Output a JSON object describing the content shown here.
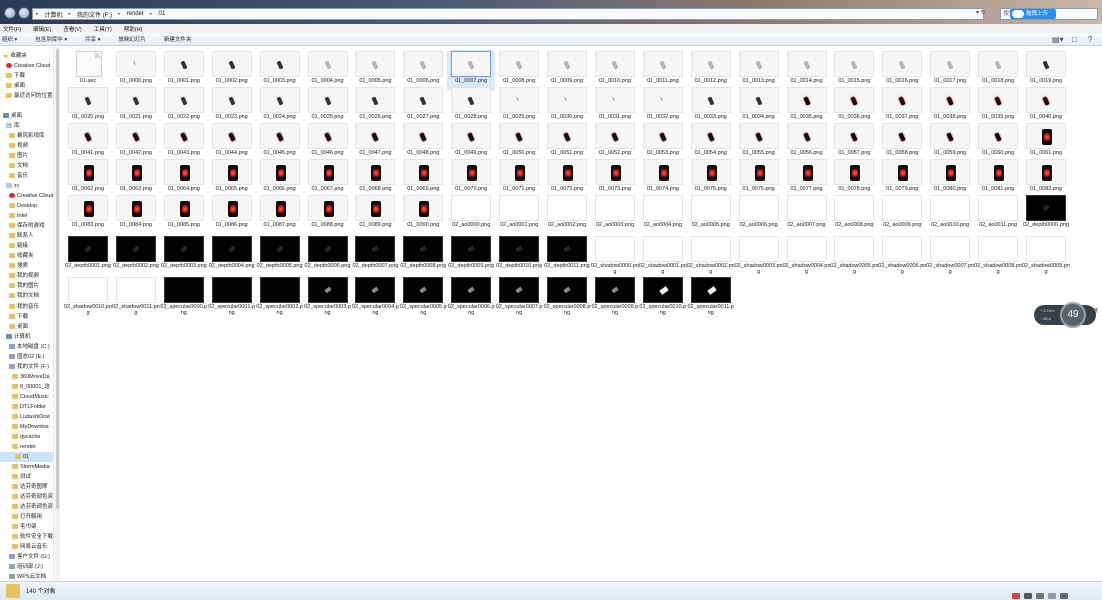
{
  "address": {
    "crumbs": [
      "计算机",
      "我的文件 (F:)",
      "render",
      "01"
    ],
    "search_placeholder": "搜索",
    "upload_label": "拖拽上传"
  },
  "menu": [
    "文件(F)",
    "编辑(E)",
    "查看(V)",
    "工具(T)",
    "帮助(H)"
  ],
  "toolbar": [
    "组织 ▾",
    "包含到库中 ▾",
    "共享 ▾",
    "放映幻灯片",
    "新建文件夹"
  ],
  "sidebar": [
    {
      "label": "收藏夹",
      "icon": "star-icon"
    },
    {
      "label": "Creative Cloud",
      "icon": "creative-cloud-icon"
    },
    {
      "label": "下载",
      "icon": "folder-icon"
    },
    {
      "label": "桌面",
      "icon": "folder-icon"
    },
    {
      "label": "最近访问的位置",
      "icon": "folder-icon"
    },
    {
      "label": "",
      "icon": ""
    },
    {
      "label": "桌面",
      "icon": "desktop-icon"
    },
    {
      "label": "库",
      "icon": "library-icon"
    },
    {
      "label": "暴风影视库",
      "icon": "folder-icon"
    },
    {
      "label": "视频",
      "icon": "folder-icon"
    },
    {
      "label": "图片",
      "icon": "folder-icon"
    },
    {
      "label": "文档",
      "icon": "folder-icon"
    },
    {
      "label": "音乐",
      "icon": "folder-icon"
    },
    {
      "label": "zc",
      "icon": "user-icon"
    },
    {
      "label": "Creative Cloud",
      "icon": "creative-cloud-icon"
    },
    {
      "label": "Desktop",
      "icon": "folder-icon"
    },
    {
      "label": "Intel",
      "icon": "folder-icon"
    },
    {
      "label": "保存的游戏",
      "icon": "folder-icon"
    },
    {
      "label": "联系人",
      "icon": "folder-icon"
    },
    {
      "label": "链接",
      "icon": "folder-icon"
    },
    {
      "label": "收藏夹",
      "icon": "folder-icon"
    },
    {
      "label": "搜索",
      "icon": "folder-icon"
    },
    {
      "label": "我的视频",
      "icon": "folder-icon"
    },
    {
      "label": "我的图片",
      "icon": "folder-icon"
    },
    {
      "label": "我的文档",
      "icon": "folder-icon"
    },
    {
      "label": "我的音乐",
      "icon": "folder-icon"
    },
    {
      "label": "下载",
      "icon": "folder-icon"
    },
    {
      "label": "桌面",
      "icon": "folder-icon"
    },
    {
      "label": "计算机",
      "icon": "computer-icon"
    },
    {
      "label": "本地磁盘 (C:)",
      "icon": "drive-icon"
    },
    {
      "label": "固态02 (E:)",
      "icon": "drive-icon"
    },
    {
      "label": "我的文件 (F:)",
      "icon": "drive-icon"
    },
    {
      "label": "360MoveDa",
      "icon": "folder-icon"
    },
    {
      "label": "8_00001_这",
      "icon": "folder-icon"
    },
    {
      "label": "CloudMusic",
      "icon": "folder-icon"
    },
    {
      "label": "DTLFolder",
      "icon": "folder-icon"
    },
    {
      "label": "LudashiDow",
      "icon": "folder-icon"
    },
    {
      "label": "MyDownloa",
      "icon": "folder-icon"
    },
    {
      "label": "qycache",
      "icon": "folder-icon"
    },
    {
      "label": "render",
      "icon": "folder-icon"
    },
    {
      "label": "01",
      "icon": "folder-icon",
      "selected": true
    },
    {
      "label": "StormMedia",
      "icon": "folder-icon"
    },
    {
      "label": "测试",
      "icon": "folder-icon"
    },
    {
      "label": "达芬奇图摩",
      "icon": "folder-icon"
    },
    {
      "label": "达芬奇调色资",
      "icon": "folder-icon"
    },
    {
      "label": "达芬奇调色资",
      "icon": "folder-icon"
    },
    {
      "label": "打开解用",
      "icon": "folder-icon"
    },
    {
      "label": "毛巾架",
      "icon": "folder-icon"
    },
    {
      "label": "软件安全下载",
      "icon": "folder-icon"
    },
    {
      "label": "网易云音乐",
      "icon": "folder-icon"
    },
    {
      "label": "客户文件 (G:)",
      "icon": "drive-icon"
    },
    {
      "label": "培训部 (J:)",
      "icon": "drive-icon"
    },
    {
      "label": "WPS云文档",
      "icon": "cloud-drive-icon"
    }
  ],
  "files": [
    {
      "name": "01.aec",
      "kind": "doc"
    },
    {
      "name": "01_0000.png",
      "kind": "tiny"
    },
    {
      "name": "01_0001.png",
      "kind": "small"
    },
    {
      "name": "01_0002.png",
      "kind": "small"
    },
    {
      "name": "01_0003.png",
      "kind": "small"
    },
    {
      "name": "01_0004.png",
      "kind": "light"
    },
    {
      "name": "01_0005.png",
      "kind": "light"
    },
    {
      "name": "01_0006.png",
      "kind": "light"
    },
    {
      "name": "01_0007.png",
      "kind": "light",
      "selected": true
    },
    {
      "name": "01_0008.png",
      "kind": "light"
    },
    {
      "name": "01_0009.png",
      "kind": "light"
    },
    {
      "name": "01_0010.png",
      "kind": "light"
    },
    {
      "name": "01_0011.png",
      "kind": "light"
    },
    {
      "name": "01_0012.png",
      "kind": "light"
    },
    {
      "name": "01_0013.png",
      "kind": "light"
    },
    {
      "name": "01_0014.png",
      "kind": "light"
    },
    {
      "name": "01_0015.png",
      "kind": "light"
    },
    {
      "name": "01_0016.png",
      "kind": "light"
    },
    {
      "name": "01_0017.png",
      "kind": "light"
    },
    {
      "name": "01_0018.png",
      "kind": "light"
    },
    {
      "name": "01_0019.png",
      "kind": "small"
    },
    {
      "name": "01_0020.png",
      "kind": "small"
    },
    {
      "name": "01_0021.png",
      "kind": "small"
    },
    {
      "name": "01_0022.png",
      "kind": "small"
    },
    {
      "name": "01_0023.png",
      "kind": "small"
    },
    {
      "name": "01_0024.png",
      "kind": "small"
    },
    {
      "name": "01_0025.png",
      "kind": "small"
    },
    {
      "name": "01_0026.png",
      "kind": "small"
    },
    {
      "name": "01_0027.png",
      "kind": "small"
    },
    {
      "name": "01_0028.png",
      "kind": "small"
    },
    {
      "name": "01_0029.png",
      "kind": "tiny"
    },
    {
      "name": "01_0030.png",
      "kind": "tiny"
    },
    {
      "name": "01_0031.png",
      "kind": "tiny"
    },
    {
      "name": "01_0032.png",
      "kind": "tiny"
    },
    {
      "name": "01_0033.png",
      "kind": "small"
    },
    {
      "name": "01_0034.png",
      "kind": "small"
    },
    {
      "name": "01_0035.png",
      "kind": "red"
    },
    {
      "name": "01_0036.png",
      "kind": "red"
    },
    {
      "name": "01_0037.png",
      "kind": "red"
    },
    {
      "name": "01_0038.png",
      "kind": "red"
    },
    {
      "name": "01_0039.png",
      "kind": "red"
    },
    {
      "name": "01_0040.png",
      "kind": "red"
    },
    {
      "name": "01_0041.png",
      "kind": "red"
    },
    {
      "name": "01_0042.png",
      "kind": "red"
    },
    {
      "name": "01_0043.png",
      "kind": "red"
    },
    {
      "name": "01_0044.png",
      "kind": "red"
    },
    {
      "name": "01_0045.png",
      "kind": "red"
    },
    {
      "name": "01_0046.png",
      "kind": "red"
    },
    {
      "name": "01_0047.png",
      "kind": "red"
    },
    {
      "name": "01_0048.png",
      "kind": "red"
    },
    {
      "name": "01_0049.png",
      "kind": "red"
    },
    {
      "name": "01_0050.png",
      "kind": "red"
    },
    {
      "name": "01_0051.png",
      "kind": "red"
    },
    {
      "name": "01_0052.png",
      "kind": "red"
    },
    {
      "name": "01_0053.png",
      "kind": "red"
    },
    {
      "name": "01_0054.png",
      "kind": "red"
    },
    {
      "name": "01_0055.png",
      "kind": "red"
    },
    {
      "name": "01_0056.png",
      "kind": "red"
    },
    {
      "name": "01_0057.png",
      "kind": "red"
    },
    {
      "name": "01_0058.png",
      "kind": "red"
    },
    {
      "name": "01_0059.png",
      "kind": "red"
    },
    {
      "name": "01_0060.png",
      "kind": "red"
    },
    {
      "name": "01_0061.png",
      "kind": "redbig"
    },
    {
      "name": "01_0062.png",
      "kind": "redbig"
    },
    {
      "name": "01_0063.png",
      "kind": "redbig"
    },
    {
      "name": "01_0064.png",
      "kind": "redbig"
    },
    {
      "name": "01_0065.png",
      "kind": "redbig"
    },
    {
      "name": "01_0066.png",
      "kind": "redbig"
    },
    {
      "name": "01_0067.png",
      "kind": "redbig"
    },
    {
      "name": "01_0068.png",
      "kind": "redbig"
    },
    {
      "name": "01_0069.png",
      "kind": "redbig"
    },
    {
      "name": "01_0070.png",
      "kind": "redbig"
    },
    {
      "name": "01_0071.png",
      "kind": "redbig"
    },
    {
      "name": "01_0072.png",
      "kind": "redbig"
    },
    {
      "name": "01_0073.png",
      "kind": "redbig"
    },
    {
      "name": "01_0074.png",
      "kind": "redbig"
    },
    {
      "name": "01_0075.png",
      "kind": "redbig"
    },
    {
      "name": "01_0076.png",
      "kind": "redbig"
    },
    {
      "name": "01_0077.png",
      "kind": "redbig"
    },
    {
      "name": "01_0078.png",
      "kind": "redbig"
    },
    {
      "name": "01_0079.png",
      "kind": "redbig"
    },
    {
      "name": "01_0080.png",
      "kind": "redbig"
    },
    {
      "name": "01_0081.png",
      "kind": "redbig"
    },
    {
      "name": "01_0082.png",
      "kind": "redbig"
    },
    {
      "name": "01_0083.png",
      "kind": "redbig"
    },
    {
      "name": "01_0084.png",
      "kind": "redbig"
    },
    {
      "name": "01_0085.png",
      "kind": "redbig"
    },
    {
      "name": "01_0086.png",
      "kind": "redbig"
    },
    {
      "name": "01_0087.png",
      "kind": "redbig"
    },
    {
      "name": "01_0088.png",
      "kind": "redbig"
    },
    {
      "name": "01_0089.png",
      "kind": "redbig"
    },
    {
      "name": "01_0090.png",
      "kind": "redbig"
    },
    {
      "name": "02_ao0000.png",
      "kind": "white"
    },
    {
      "name": "02_ao0001.png",
      "kind": "white"
    },
    {
      "name": "02_ao0002.png",
      "kind": "white"
    },
    {
      "name": "02_ao0003.png",
      "kind": "white"
    },
    {
      "name": "02_ao0004.png",
      "kind": "white"
    },
    {
      "name": "02_ao0005.png",
      "kind": "white"
    },
    {
      "name": "02_ao0006.png",
      "kind": "white"
    },
    {
      "name": "02_ao0007.png",
      "kind": "white"
    },
    {
      "name": "02_ao0008.png",
      "kind": "white"
    },
    {
      "name": "02_ao0009.png",
      "kind": "white"
    },
    {
      "name": "02_ao0010.png",
      "kind": "white"
    },
    {
      "name": "02_ao0011.png",
      "kind": "white"
    },
    {
      "name": "02_depth0000.png",
      "kind": "black"
    },
    {
      "name": "02_depth0001.png",
      "kind": "black"
    },
    {
      "name": "02_depth0002.png",
      "kind": "black"
    },
    {
      "name": "02_depth0003.png",
      "kind": "black"
    },
    {
      "name": "02_depth0004.png",
      "kind": "black"
    },
    {
      "name": "02_depth0005.png",
      "kind": "black"
    },
    {
      "name": "02_depth0006.png",
      "kind": "black"
    },
    {
      "name": "02_depth0007.png",
      "kind": "black"
    },
    {
      "name": "02_depth0008.png",
      "kind": "black"
    },
    {
      "name": "02_depth0009.png",
      "kind": "black"
    },
    {
      "name": "02_depth0010.png",
      "kind": "black"
    },
    {
      "name": "02_depth0011.png",
      "kind": "black"
    },
    {
      "name": "02_shadow0000.png",
      "kind": "white"
    },
    {
      "name": "02_shadow0001.png",
      "kind": "white"
    },
    {
      "name": "02_shadow0002.png",
      "kind": "white"
    },
    {
      "name": "02_shadow0003.png",
      "kind": "white"
    },
    {
      "name": "02_shadow0004.png",
      "kind": "white"
    },
    {
      "name": "02_shadow0005.png",
      "kind": "white"
    },
    {
      "name": "02_shadow0006.png",
      "kind": "white"
    },
    {
      "name": "02_shadow0007.png",
      "kind": "white"
    },
    {
      "name": "02_shadow0008.png",
      "kind": "white"
    },
    {
      "name": "02_shadow0009.png",
      "kind": "white"
    },
    {
      "name": "02_shadow0010.png",
      "kind": "white"
    },
    {
      "name": "02_shadow0011.png",
      "kind": "white"
    },
    {
      "name": "02_specular0000.png",
      "kind": "black"
    },
    {
      "name": "02_specular0001.png",
      "kind": "black"
    },
    {
      "name": "02_specular0002.png",
      "kind": "black"
    },
    {
      "name": "02_specular0003.png",
      "kind": "black"
    },
    {
      "name": "02_specular0004.png",
      "kind": "black"
    },
    {
      "name": "02_specular0005.png",
      "kind": "black"
    },
    {
      "name": "02_specular0006.png",
      "kind": "black"
    },
    {
      "name": "02_specular0007.png",
      "kind": "black"
    },
    {
      "name": "02_specular0008.png",
      "kind": "black"
    },
    {
      "name": "02_specular0009.png",
      "kind": "black"
    },
    {
      "name": "02_specular0010.png",
      "kind": "black"
    },
    {
      "name": "02_specular0011.png",
      "kind": "black"
    }
  ],
  "widget": {
    "line1": "↑ 0.1K/s",
    "line2": "↓ 0K/s",
    "percent": "49",
    "side_note": "加速"
  },
  "status": {
    "count_text": "140 个对象"
  }
}
